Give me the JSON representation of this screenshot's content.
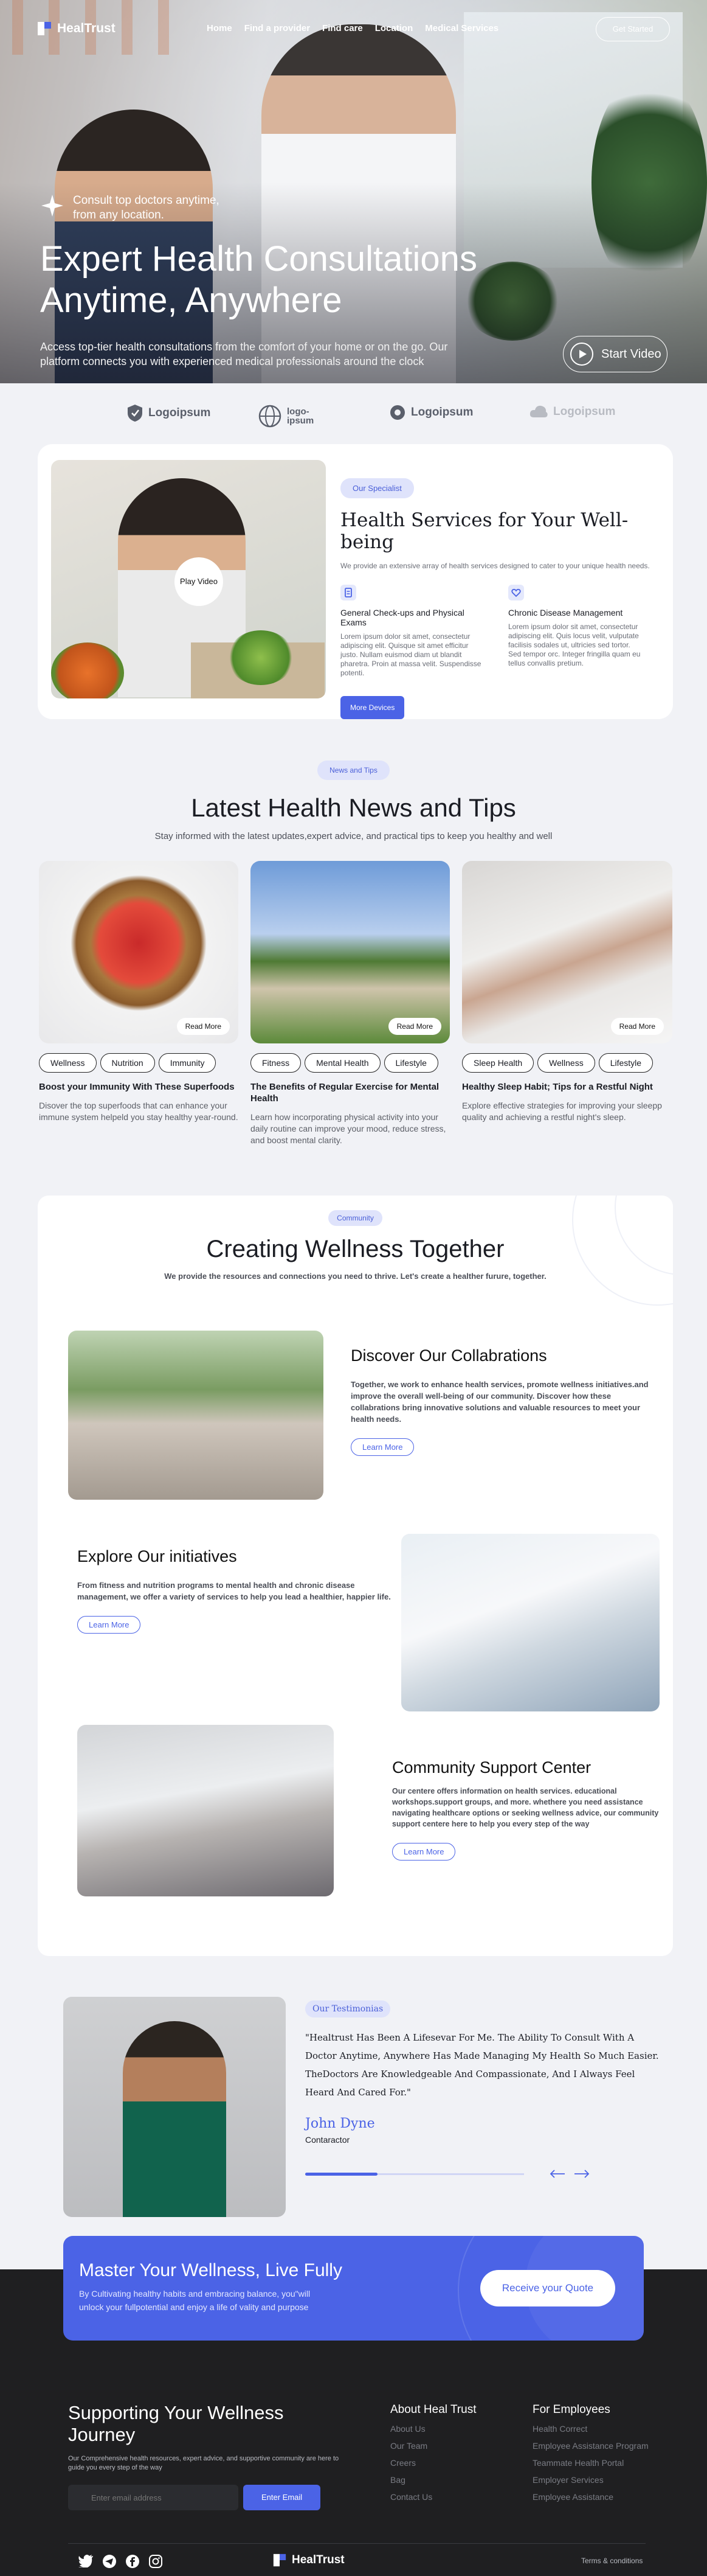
{
  "brand": {
    "name": "HealTrust",
    "accent": "#4b63e6"
  },
  "nav": {
    "links": [
      "Home",
      "Find a provider",
      "Find care",
      "Location",
      "Medical Services"
    ],
    "cta": "Get Started"
  },
  "hero": {
    "consult_line1": "Consult top doctors anytime,",
    "consult_line2": "from any location.",
    "title_line1": "Expert Health Consultations",
    "title_line2": "Anytime, Anywhere",
    "sub_line1": "Access top-tier health consultations from the comfort of your home or on the go. Our",
    "sub_line2": "platform connects you with experienced medical professionals around the clock",
    "video_label": "Start Video"
  },
  "partners": [
    {
      "name": "Logoipsum",
      "icon": "shield-logo-icon"
    },
    {
      "name": "logo-\nipsum",
      "icon": "globe-logo-icon"
    },
    {
      "name": "Logoipsum",
      "icon": "drop-logo-icon"
    },
    {
      "name": "Logoipsum",
      "icon": "cloud-logo-icon"
    }
  ],
  "services": {
    "pill": "Our Specialist",
    "title": "Health Services for Your Well-being",
    "subtitle": "We provide an extensive array of health services designed to cater to your unique health needs.",
    "play_label": "Play Video",
    "items": [
      {
        "title": "General Check-ups and Physical Exams",
        "icon": "clipboard-icon",
        "text": "Lorem ipsum dolor sit amet, consectetur adipiscing elit. Quisque sit amet efficitur justo. Nullam euismod diam ut blandit pharetra. Proin at massa velit. Suspendisse potenti."
      },
      {
        "title": "Chronic Disease Management",
        "icon": "heart-shield-icon",
        "text": "Lorem ipsum dolor sit amet, consectetur adipiscing elit. Quis locus velit, vulputate facilisis sodales ut, ultricies sed tortor. Sed tempor orc. Integer fringilla quam eu tellus convallis pretium."
      }
    ],
    "button": "More Devices"
  },
  "news": {
    "pill": "News and Tips",
    "title": "Latest Health News and Tips",
    "subtitle": "Stay informed with the latest updates,expert advice, and practical tips to keep you healthy and well",
    "read_more": "Read More",
    "cards": [
      {
        "tags": [
          "Wellness",
          "Nutrition",
          "Immunity"
        ],
        "title": "Boost your Immunity With These Superfoods",
        "desc": "Disover the top superfoods that can enhance your immune system helpeld you stay healthy year-round."
      },
      {
        "tags": [
          "Fitness",
          "Mental Health",
          "Lifestyle"
        ],
        "title": "The Benefits of Regular Exercise for Mental Health",
        "desc": "Learn how incorporating physical activity into your daily routine can improve your mood, reduce stress, and boost mental clarity."
      },
      {
        "tags": [
          "Sleep Health",
          "Wellness",
          "Lifestyle"
        ],
        "title": "Healthy Sleep Habit; Tips for a Restful Night",
        "desc": "Explore effective strategies for improving your sleepp quality and achieving a restful night's sleep."
      }
    ]
  },
  "community": {
    "pill": "Community",
    "title": "Creating Wellness Together",
    "subtitle": "We provide the resources and connections you need to thrive. Let's create a healther furure, together.",
    "learn_more": "Learn More",
    "blocks": [
      {
        "title": "Discover Our Collabrations",
        "text": "Together, we work to enhance health services, promote wellness initiatives.and improve the overall well-being of our community. Discover how these collabrations bring innovative solutions and valuable resources to meet your health needs."
      },
      {
        "title": "Explore Our initiatives",
        "text": "From fitness and nutrition programs to mental health and chronic disease management, we offer a variety of services to help you lead a healthier, happier life."
      },
      {
        "title": "Community Support Center",
        "text": "Our centere offers information on health services. educational workshops.support groups, and more. whethere you need assistance navigating healthcare options or seeking wellness advice, our community support centere here to help you every step of the way"
      }
    ]
  },
  "testimonial": {
    "pill": "Our Testimonias",
    "quote": "\"Healtrust Has Been A Lifesevar For Me. The Ability To Consult With A Doctor Anytime, Anywhere Has Made Managing My Health So Much Easier. TheDoctors Are Knowledgeable And Compassionate, And I Always Feel Heard And Cared For.\"",
    "name": "John Dyne",
    "role": "Contaractor",
    "progress": 0.33
  },
  "cta": {
    "title": "Master Your Wellness, Live Fully",
    "text_line1": "By Cultivating healthy habits and embracing balance, you\"will",
    "text_line2": "unlock your fullpotential and enjoy a life of vality and purpose",
    "button": "Receive your Quote"
  },
  "footer": {
    "heading_line1": "Supporting Your Wellness",
    "heading_line2": "Journey",
    "desc": "Our Comprehensive health resources, expert advice, and supportive community are here to guide you every step of the way",
    "email_placeholder": "Enter email address",
    "email_button": "Enter Email",
    "col1_title": "About Heal Trust",
    "col1": [
      "About Us",
      "Our Team",
      "Creers",
      "Bag",
      "Contact Us"
    ],
    "col2_title": "For Employees",
    "col2": [
      "Health Correct",
      "Employee Assistance Program",
      "Teammate Health Portal",
      "Employer Services",
      "Employee Assistance"
    ],
    "brand": "HealTrust",
    "terms": "Terms & conditions",
    "social": [
      "twitter-icon",
      "telegram-icon",
      "facebook-icon",
      "instagram-icon"
    ]
  }
}
